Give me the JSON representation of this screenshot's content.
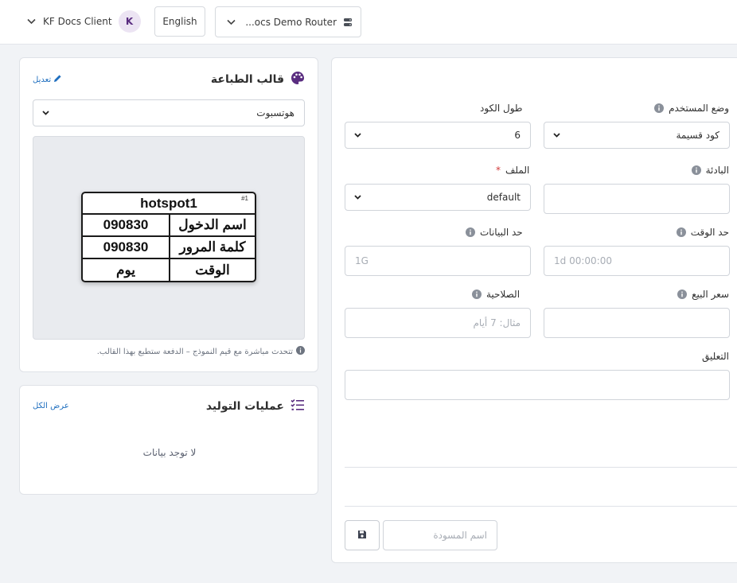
{
  "header": {
    "client_name": "KF Docs Client",
    "avatar_letter": "K",
    "language": "English",
    "router_name": "...ocs Demo Router"
  },
  "template_card": {
    "title": "قالب الطباعة",
    "edit_label": "تعديل",
    "selected_template": "هوتسبوت",
    "ticket": {
      "title": "hotspot1",
      "number": "#1",
      "rows": [
        {
          "label": "اسم الدخول",
          "value": "090830"
        },
        {
          "label": "كلمة المرور",
          "value": "090830"
        },
        {
          "label": "الوقت",
          "value": "يوم"
        }
      ]
    },
    "hint": "تتحدث مباشرة مع قيم النموذج – الدفعة ستطبع بهذا القالب."
  },
  "operations_card": {
    "title": "عمليات التوليد",
    "view_all_label": "عرض الكل",
    "empty_text": "لا توجد بيانات"
  },
  "form": {
    "user_mode": {
      "label": "وضع المستخدم",
      "value": "كود قسيمة"
    },
    "code_length": {
      "label": "طول الكود",
      "value": "6"
    },
    "prefix": {
      "label": "البادئة",
      "value": ""
    },
    "profile": {
      "label": "الملف",
      "required_mark": "*",
      "value": "default"
    },
    "time_limit": {
      "label": "حد الوقت",
      "placeholder": "1d 00:00:00"
    },
    "data_limit": {
      "label": "حد البيانات",
      "placeholder": "1G"
    },
    "sale_price": {
      "label": "سعر البيع",
      "value": ""
    },
    "validity": {
      "label": "الصلاحية",
      "placeholder": "مثال: 7 أيام"
    },
    "comment": {
      "label": "التعليق",
      "value": ""
    },
    "draft_name": {
      "placeholder": "اسم المسودة"
    }
  },
  "colors": {
    "accent_purple": "#5a2d80",
    "link_blue": "#1f6fbf",
    "required_red": "#d23b3b"
  },
  "icons": {
    "template": "palette-icon",
    "edit": "pencil-icon",
    "operations": "list-check-icon",
    "info": "info-icon",
    "save": "save-icon",
    "router": "server-icon",
    "dropdown": "chevron-down-icon"
  }
}
